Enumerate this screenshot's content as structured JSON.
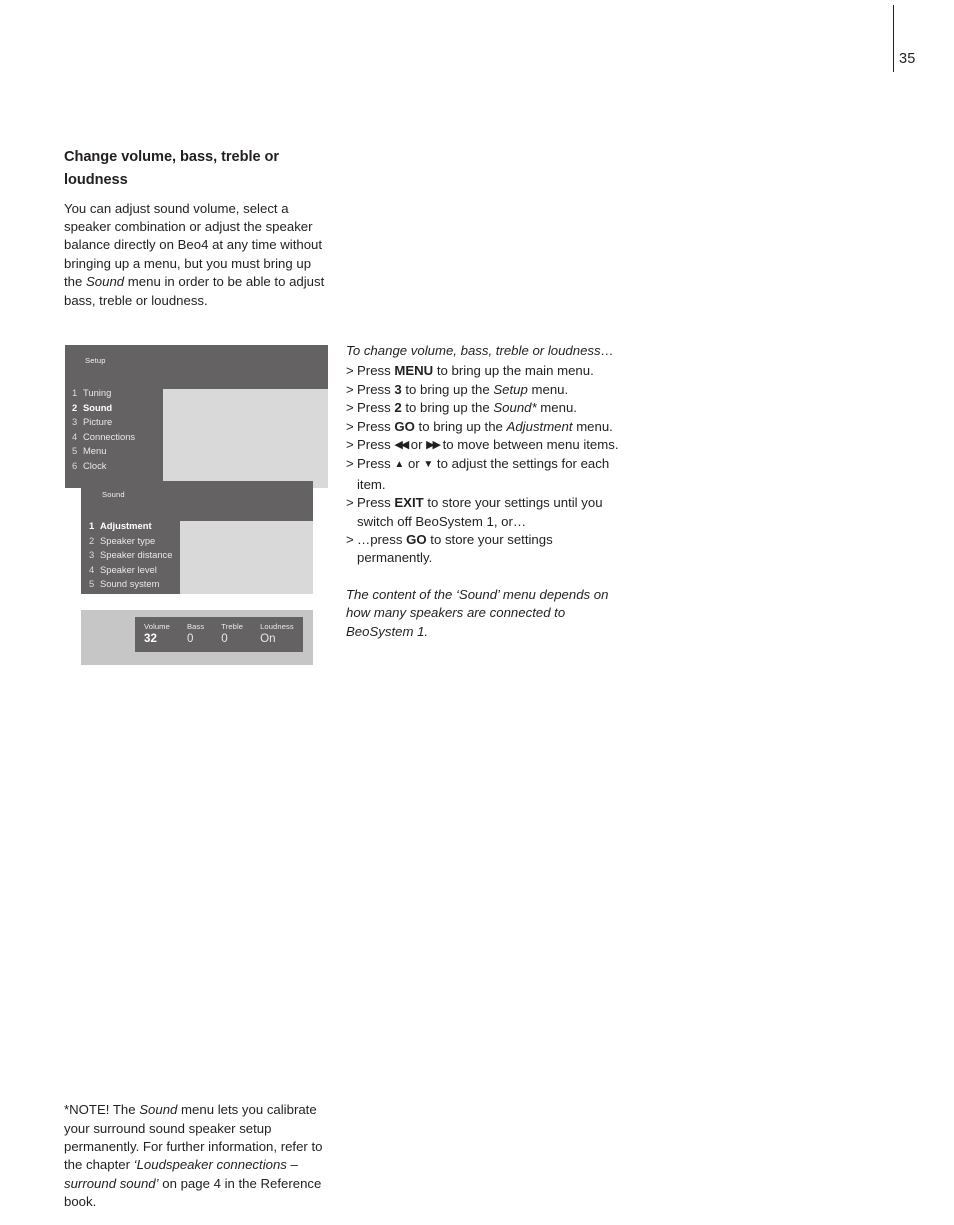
{
  "page": {
    "number": "35"
  },
  "article": {
    "heading": "Change volume, bass, treble or loudness",
    "intro_parts": {
      "before": "You can adjust sound volume, select a speaker combination or adjust the speaker balance directly on Beo4 at any time without bringing up a menu, but you must bring up the ",
      "italic": "Sound",
      "after": " menu in order to be able to adjust bass, treble or loudness."
    }
  },
  "instructions": {
    "title": "To change volume, bass, treble or loudness…",
    "marker": ">",
    "steps": [
      {
        "pre": "Press ",
        "key": "MENU",
        "post": " to bring up the main menu."
      },
      {
        "pre": "Press ",
        "key": "3",
        "post": " to bring up the ",
        "italic": "Setup",
        "tail": " menu."
      },
      {
        "pre": "Press ",
        "key": "2",
        "post": " to bring up the ",
        "italic": "Sound*",
        "tail": " menu."
      },
      {
        "pre": "Press ",
        "key": "GO",
        "post": " to bring up the ",
        "italic": "Adjustment",
        "tail": " menu."
      },
      {
        "pre": "Press ",
        "glyph_left": "◀◀",
        "mid": " or ",
        "glyph_right": "▶▶",
        "post": " to move between menu items."
      },
      {
        "pre": "Press ",
        "glyph_up": "▲",
        "mid": " or ",
        "glyph_down": "▼",
        "post": " to adjust the settings for each item."
      },
      {
        "pre": "Press ",
        "key": "EXIT",
        "post": " to store your settings until you switch off BeoSystem 1, or…"
      },
      {
        "pre": "…press ",
        "key": "GO",
        "post": " to store your settings permanently."
      }
    ],
    "caption": "The content of the ‘Sound’ menu depends on how many speakers are connected to BeoSystem 1."
  },
  "footnote": {
    "before": "*NOTE! The ",
    "italic1": "Sound",
    "middle": " menu lets you calibrate your surround sound speaker setup permanently. For further information, refer to the chapter ",
    "italic2": "‘Loudspeaker connections – surround sound’",
    "after": " on page 4 in the Reference book."
  },
  "menus": {
    "setup": {
      "title": "Setup",
      "items": [
        {
          "num": "1",
          "label": "Tuning",
          "selected": false
        },
        {
          "num": "2",
          "label": "Sound",
          "selected": true
        },
        {
          "num": "3",
          "label": "Picture",
          "selected": false
        },
        {
          "num": "4",
          "label": "Connections",
          "selected": false
        },
        {
          "num": "5",
          "label": "Menu",
          "selected": false
        },
        {
          "num": "6",
          "label": "Clock",
          "selected": false
        }
      ]
    },
    "sound": {
      "title": "Sound",
      "items": [
        {
          "num": "1",
          "label": "Adjustment",
          "selected": true
        },
        {
          "num": "2",
          "label": "Speaker type",
          "selected": false
        },
        {
          "num": "3",
          "label": "Speaker distance",
          "selected": false
        },
        {
          "num": "4",
          "label": "Speaker level",
          "selected": false
        },
        {
          "num": "5",
          "label": "Sound system",
          "selected": false
        }
      ]
    },
    "adjustment": {
      "values": [
        {
          "label": "Volume",
          "value": "32",
          "active": true
        },
        {
          "label": "Bass",
          "value": "0",
          "active": false
        },
        {
          "label": "Treble",
          "value": "0",
          "active": false
        },
        {
          "label": "Loudness",
          "value": "On",
          "active": false
        }
      ]
    }
  },
  "colors": {
    "panel_dark": "#646263",
    "panel_light": "#d9d9d9",
    "panel_grayer": "#c6c6c6",
    "text": "#231f20"
  }
}
